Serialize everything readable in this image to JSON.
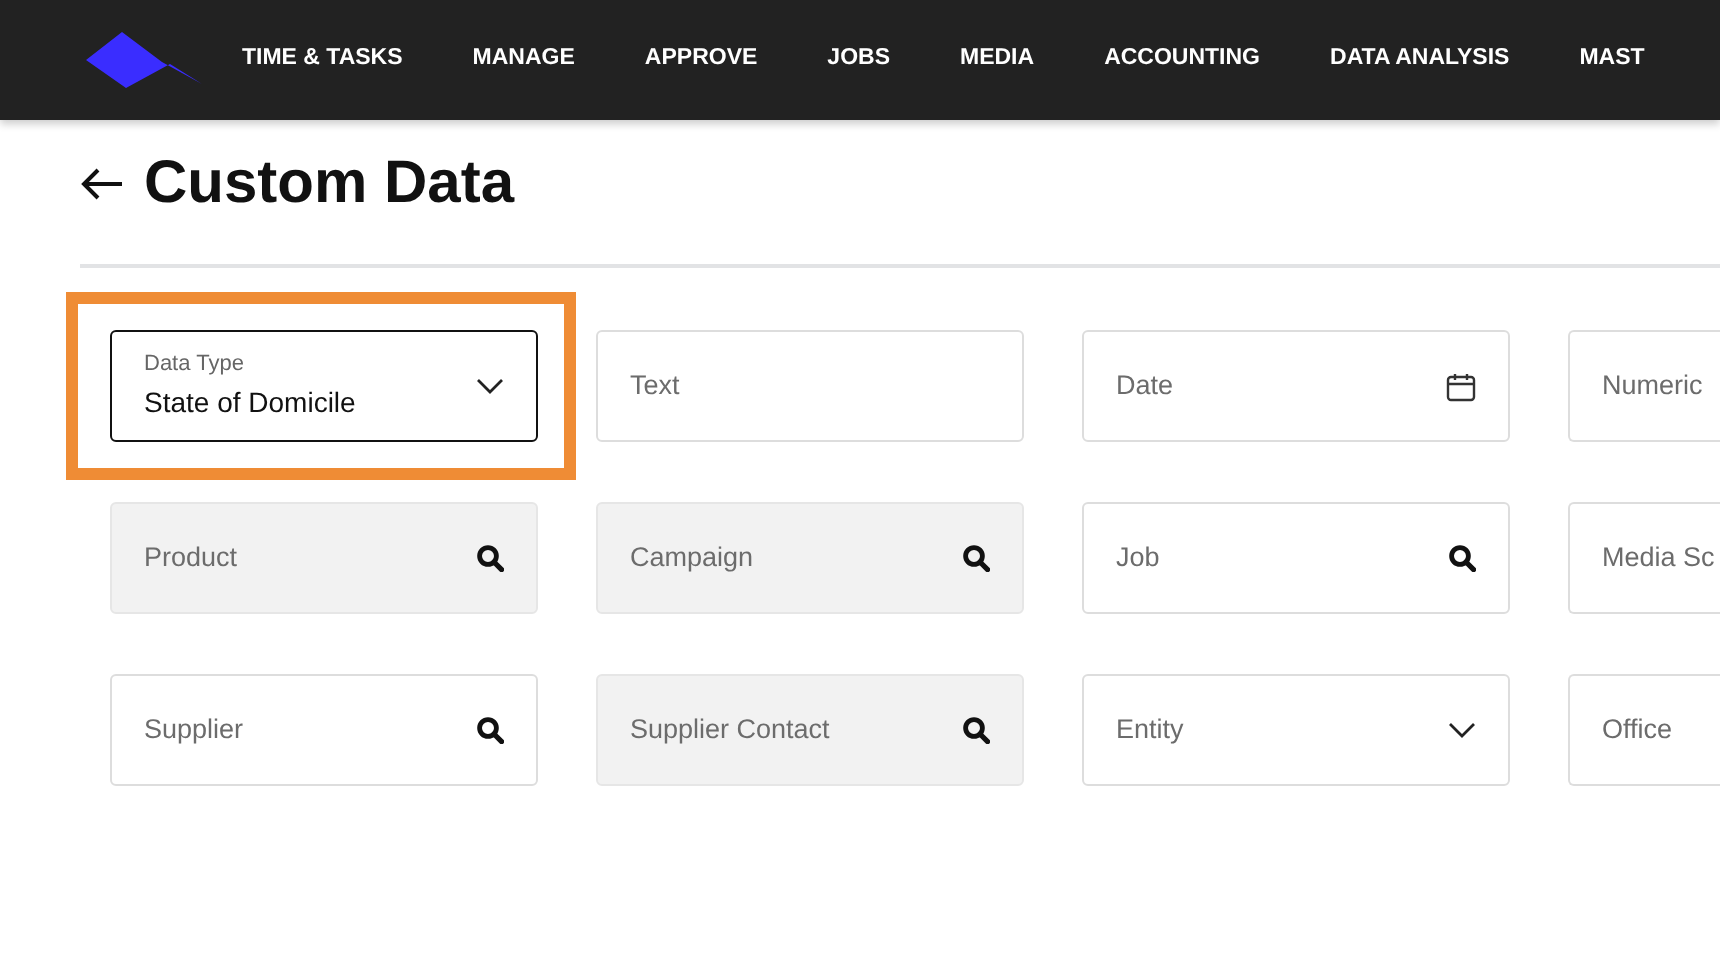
{
  "nav": {
    "items": [
      "TIME & TASKS",
      "MANAGE",
      "APPROVE",
      "JOBS",
      "MEDIA",
      "ACCOUNTING",
      "DATA ANALYSIS",
      "MAST"
    ]
  },
  "page": {
    "title": "Custom Data"
  },
  "fields": [
    {
      "kind": "select",
      "label": "Data Type",
      "value": "State of Domicile",
      "highlighted": true,
      "disabled": false
    },
    {
      "kind": "text",
      "placeholder": "Text",
      "disabled": false
    },
    {
      "kind": "date",
      "placeholder": "Date",
      "disabled": false
    },
    {
      "kind": "text",
      "placeholder": "Numeric",
      "disabled": false
    },
    {
      "kind": "search",
      "placeholder": "Product",
      "disabled": true
    },
    {
      "kind": "search",
      "placeholder": "Campaign",
      "disabled": true
    },
    {
      "kind": "search",
      "placeholder": "Job",
      "disabled": false
    },
    {
      "kind": "text",
      "placeholder": "Media Sc",
      "disabled": false
    },
    {
      "kind": "search",
      "placeholder": "Supplier",
      "disabled": false
    },
    {
      "kind": "search",
      "placeholder": "Supplier Contact",
      "disabled": true
    },
    {
      "kind": "dropdown",
      "placeholder": "Entity",
      "disabled": false
    },
    {
      "kind": "text",
      "placeholder": "Office",
      "disabled": false
    }
  ]
}
